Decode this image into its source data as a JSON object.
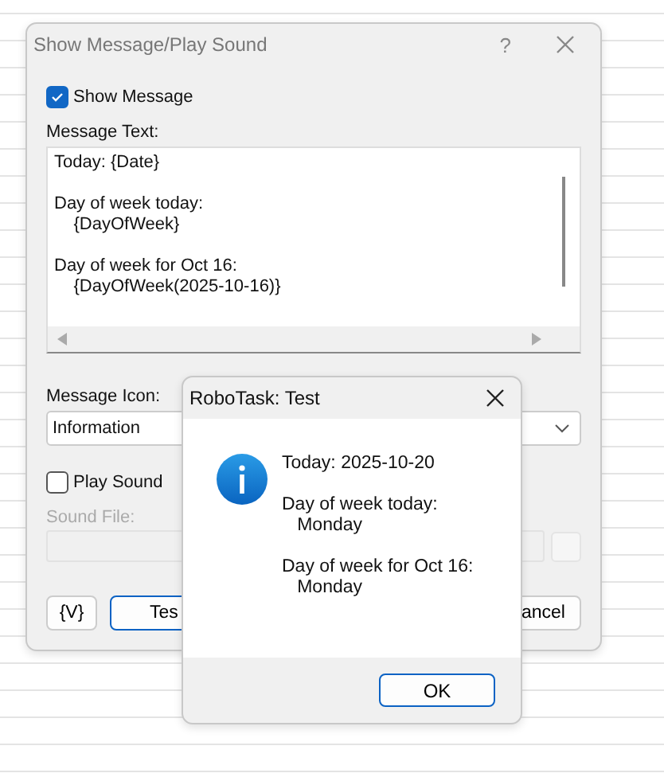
{
  "main_dialog": {
    "title": "Show Message/Play Sound",
    "help": "?",
    "show_message": {
      "label": "Show Message",
      "checked": true
    },
    "message_text": {
      "label": "Message Text:",
      "value": "Today: {Date}\n\nDay of week today:\n\t{DayOfWeek}\n\nDay of week for Oct 16:\n\t{DayOfWeek(2025-10-16)}"
    },
    "message_icon": {
      "label": "Message Icon:",
      "value": "Information"
    },
    "play_sound": {
      "label": "Play Sound",
      "checked": false
    },
    "sound_file": {
      "label": "Sound File:",
      "disabled": true
    },
    "buttons": [
      {
        "label": "{V}",
        "kind": "plain"
      },
      {
        "label": "Tes",
        "kind": "default"
      },
      {
        "label": "ancel",
        "kind": "plain"
      }
    ]
  },
  "popup": {
    "title": "RoboTask: Test",
    "message": "Today: 2025-10-20\n\nDay of week today:\n\tMonday\n\nDay of week for Oct 16:\n\tMonday",
    "button": "OK"
  }
}
